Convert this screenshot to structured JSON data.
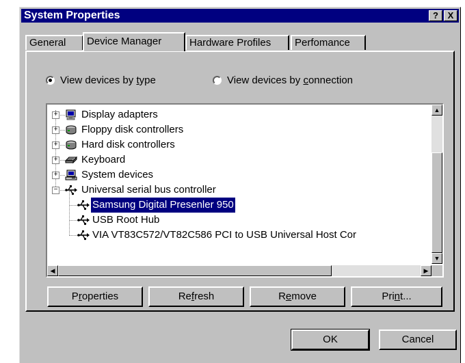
{
  "window": {
    "title": "System Properties",
    "help_button": "?",
    "close_button": "X"
  },
  "tabs": [
    {
      "label": "General",
      "active": false
    },
    {
      "label": "Device Manager",
      "active": true
    },
    {
      "label": "Hardware Profiles",
      "active": false
    },
    {
      "label": "Perfomance",
      "active": false
    }
  ],
  "view_options": {
    "by_type": {
      "prefix": "View devices by ",
      "accel": "t",
      "suffix": "ype",
      "checked": true
    },
    "by_connection": {
      "prefix": "View devices by ",
      "accel": "c",
      "suffix": "onnection",
      "checked": false
    }
  },
  "tree": {
    "items": [
      {
        "label": "Display adapters",
        "expander": "+",
        "icon": "monitor-icon",
        "level": 0
      },
      {
        "label": "Floppy disk controllers",
        "expander": "+",
        "icon": "disk-controller-icon",
        "level": 0
      },
      {
        "label": "Hard disk controllers",
        "expander": "+",
        "icon": "disk-controller-icon",
        "level": 0
      },
      {
        "label": "Keyboard",
        "expander": "+",
        "icon": "keyboard-icon",
        "level": 0
      },
      {
        "label": "System devices",
        "expander": "+",
        "icon": "computer-icon",
        "level": 0
      },
      {
        "label": "Universal serial bus controller",
        "expander": "−",
        "icon": "usb-icon",
        "level": 0
      },
      {
        "label": "Samsung Digital Presenler 950",
        "icon": "usb-icon",
        "level": 1,
        "selected": true
      },
      {
        "label": "USB Root Hub",
        "icon": "usb-icon",
        "level": 1
      },
      {
        "label": "VIA VT83C572/VT82C586 PCI to USB Universal Host Cor",
        "icon": "usb-icon",
        "level": 1
      }
    ]
  },
  "buttons": {
    "properties": {
      "prefix": "P",
      "accel": "r",
      "suffix": "operties"
    },
    "refresh": {
      "prefix": "Re",
      "accel": "f",
      "suffix": "resh"
    },
    "remove": {
      "prefix": "R",
      "accel": "e",
      "suffix": "move"
    },
    "print": {
      "prefix": "Pri",
      "accel": "n",
      "suffix": "t..."
    },
    "ok": "OK",
    "cancel": "Cancel"
  },
  "colors": {
    "titlebar": "#000080",
    "face": "#c0c0c0",
    "selection": "#000080"
  }
}
